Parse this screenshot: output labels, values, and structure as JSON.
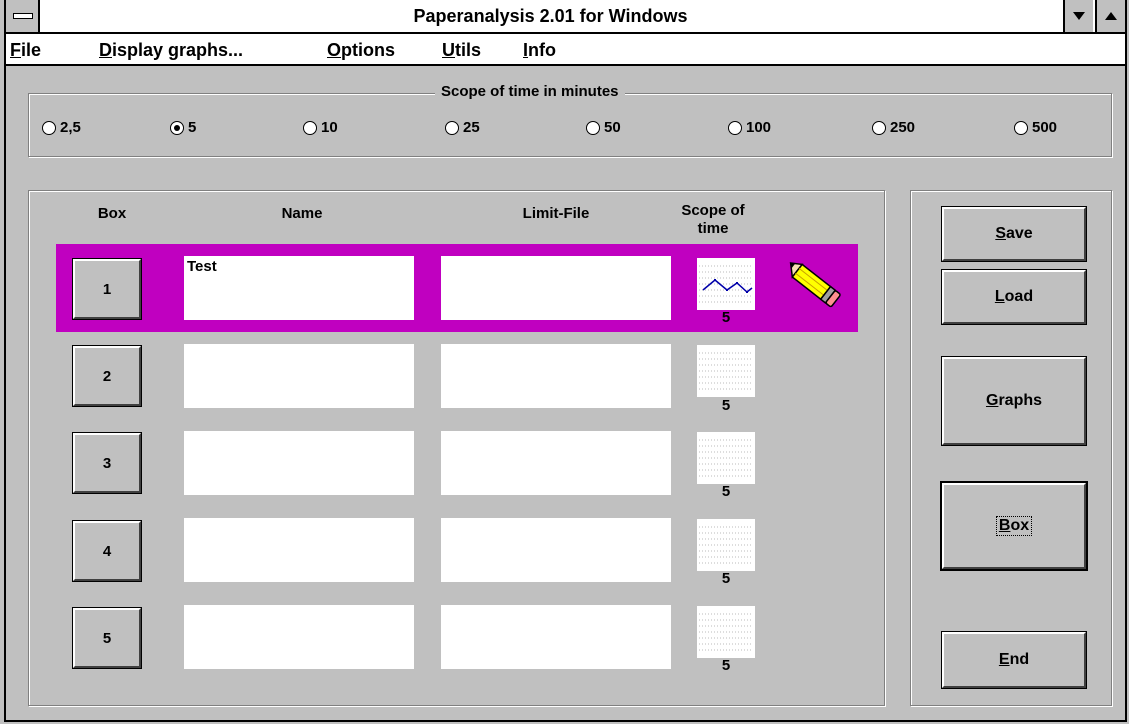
{
  "window": {
    "title": "Paperanalysis 2.01 for Windows"
  },
  "menu": [
    {
      "mnemonic": "F",
      "rest": "ile"
    },
    {
      "mnemonic": "D",
      "rest": "isplay graphs..."
    },
    {
      "mnemonic": "O",
      "rest": "ptions"
    },
    {
      "mnemonic": "U",
      "rest": "tils"
    },
    {
      "mnemonic": "I",
      "rest": "nfo"
    }
  ],
  "scope": {
    "label": "Scope of time in minutes",
    "options": [
      "2,5",
      "5",
      "10",
      "25",
      "50",
      "100",
      "250",
      "500"
    ],
    "selected": "5"
  },
  "table": {
    "headers": {
      "box": "Box",
      "name": "Name",
      "limit_file": "Limit-File",
      "scope": "Scope of\ntime"
    },
    "rows": [
      {
        "box": "1",
        "name": "Test",
        "limit_file": "",
        "scope": "5",
        "active": true
      },
      {
        "box": "2",
        "name": "",
        "limit_file": "",
        "scope": "5",
        "active": false
      },
      {
        "box": "3",
        "name": "",
        "limit_file": "",
        "scope": "5",
        "active": false
      },
      {
        "box": "4",
        "name": "",
        "limit_file": "",
        "scope": "5",
        "active": false
      },
      {
        "box": "5",
        "name": "",
        "limit_file": "",
        "scope": "5",
        "active": false
      }
    ]
  },
  "buttons": {
    "save": {
      "mnemonic": "S",
      "rest": "ave"
    },
    "load": {
      "mnemonic": "L",
      "rest": "oad"
    },
    "graphs": {
      "mnemonic": "G",
      "rest": "raphs"
    },
    "box": {
      "mnemonic": "B",
      "rest": "ox"
    },
    "end": {
      "mnemonic": "E",
      "rest": "nd"
    }
  },
  "icons": {
    "edit": "pencil-icon"
  },
  "colors": {
    "active_row": "#c000c0",
    "face": "#c0c0c0",
    "graph_line": "#0000aa"
  }
}
